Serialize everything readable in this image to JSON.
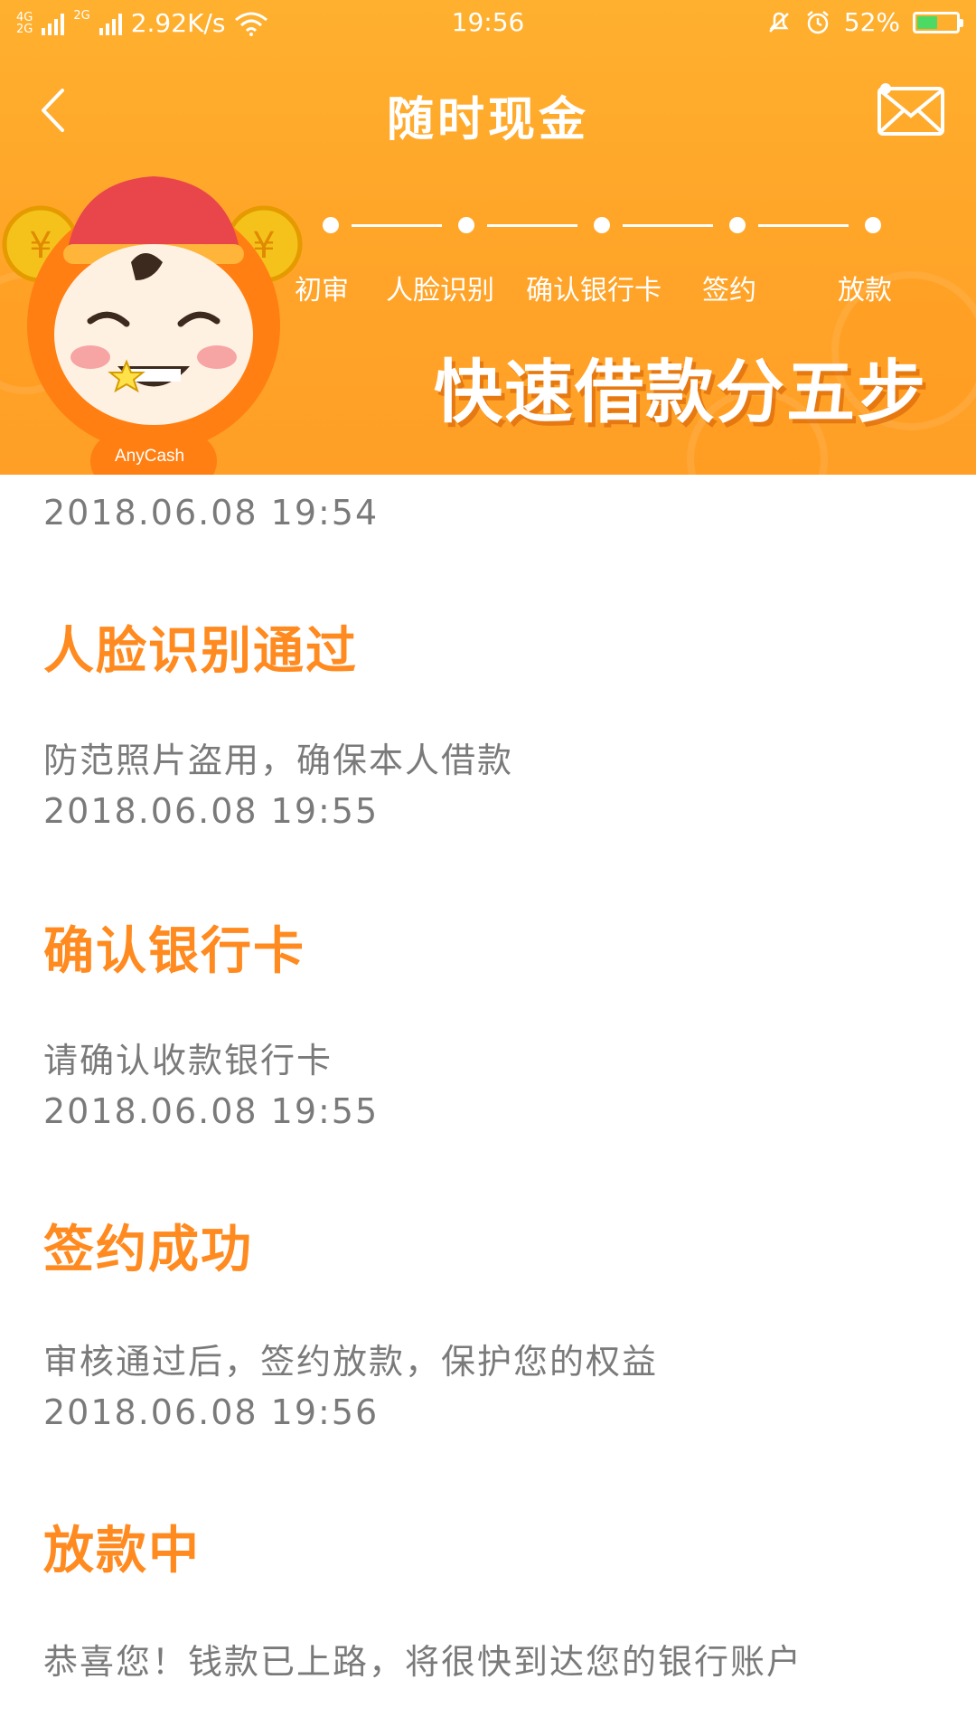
{
  "status_bar": {
    "network_tag_top": "4G",
    "network_tag_bottom": "2G",
    "network_tag2": "2G",
    "speed": "2.92K/s",
    "time": "19:56",
    "battery": "52%",
    "battery_level": 0.52,
    "battery_fill_color": "#4cd964"
  },
  "nav": {
    "title": "随时现金",
    "back_icon": "chevron-left-icon",
    "mail_icon": "mail-icon"
  },
  "banner": {
    "steps": [
      "初审",
      "人脸识别",
      "确认银行卡",
      "签约",
      "放款"
    ],
    "slogan": "快速借款分五步",
    "brand": "AnyCash",
    "accent_color": "#ffa629"
  },
  "timeline": {
    "first_time": "2018.06.08  19:54",
    "items": [
      {
        "title": "人脸识别通过",
        "desc": "防范照片盗用，确保本人借款",
        "time": "2018.06.08  19:55"
      },
      {
        "title": "确认银行卡",
        "desc": "请确认收款银行卡",
        "time": "2018.06.08  19:55"
      },
      {
        "title": "签约成功",
        "desc": "审核通过后，签约放款，保护您的权益",
        "time": "2018.06.08  19:56"
      },
      {
        "title": "放款中",
        "desc": "恭喜您！钱款已上路，将很快到达您的银行账户",
        "time": ""
      }
    ],
    "title_color": "#ff8a1f",
    "text_color": "#7a7a7a"
  }
}
